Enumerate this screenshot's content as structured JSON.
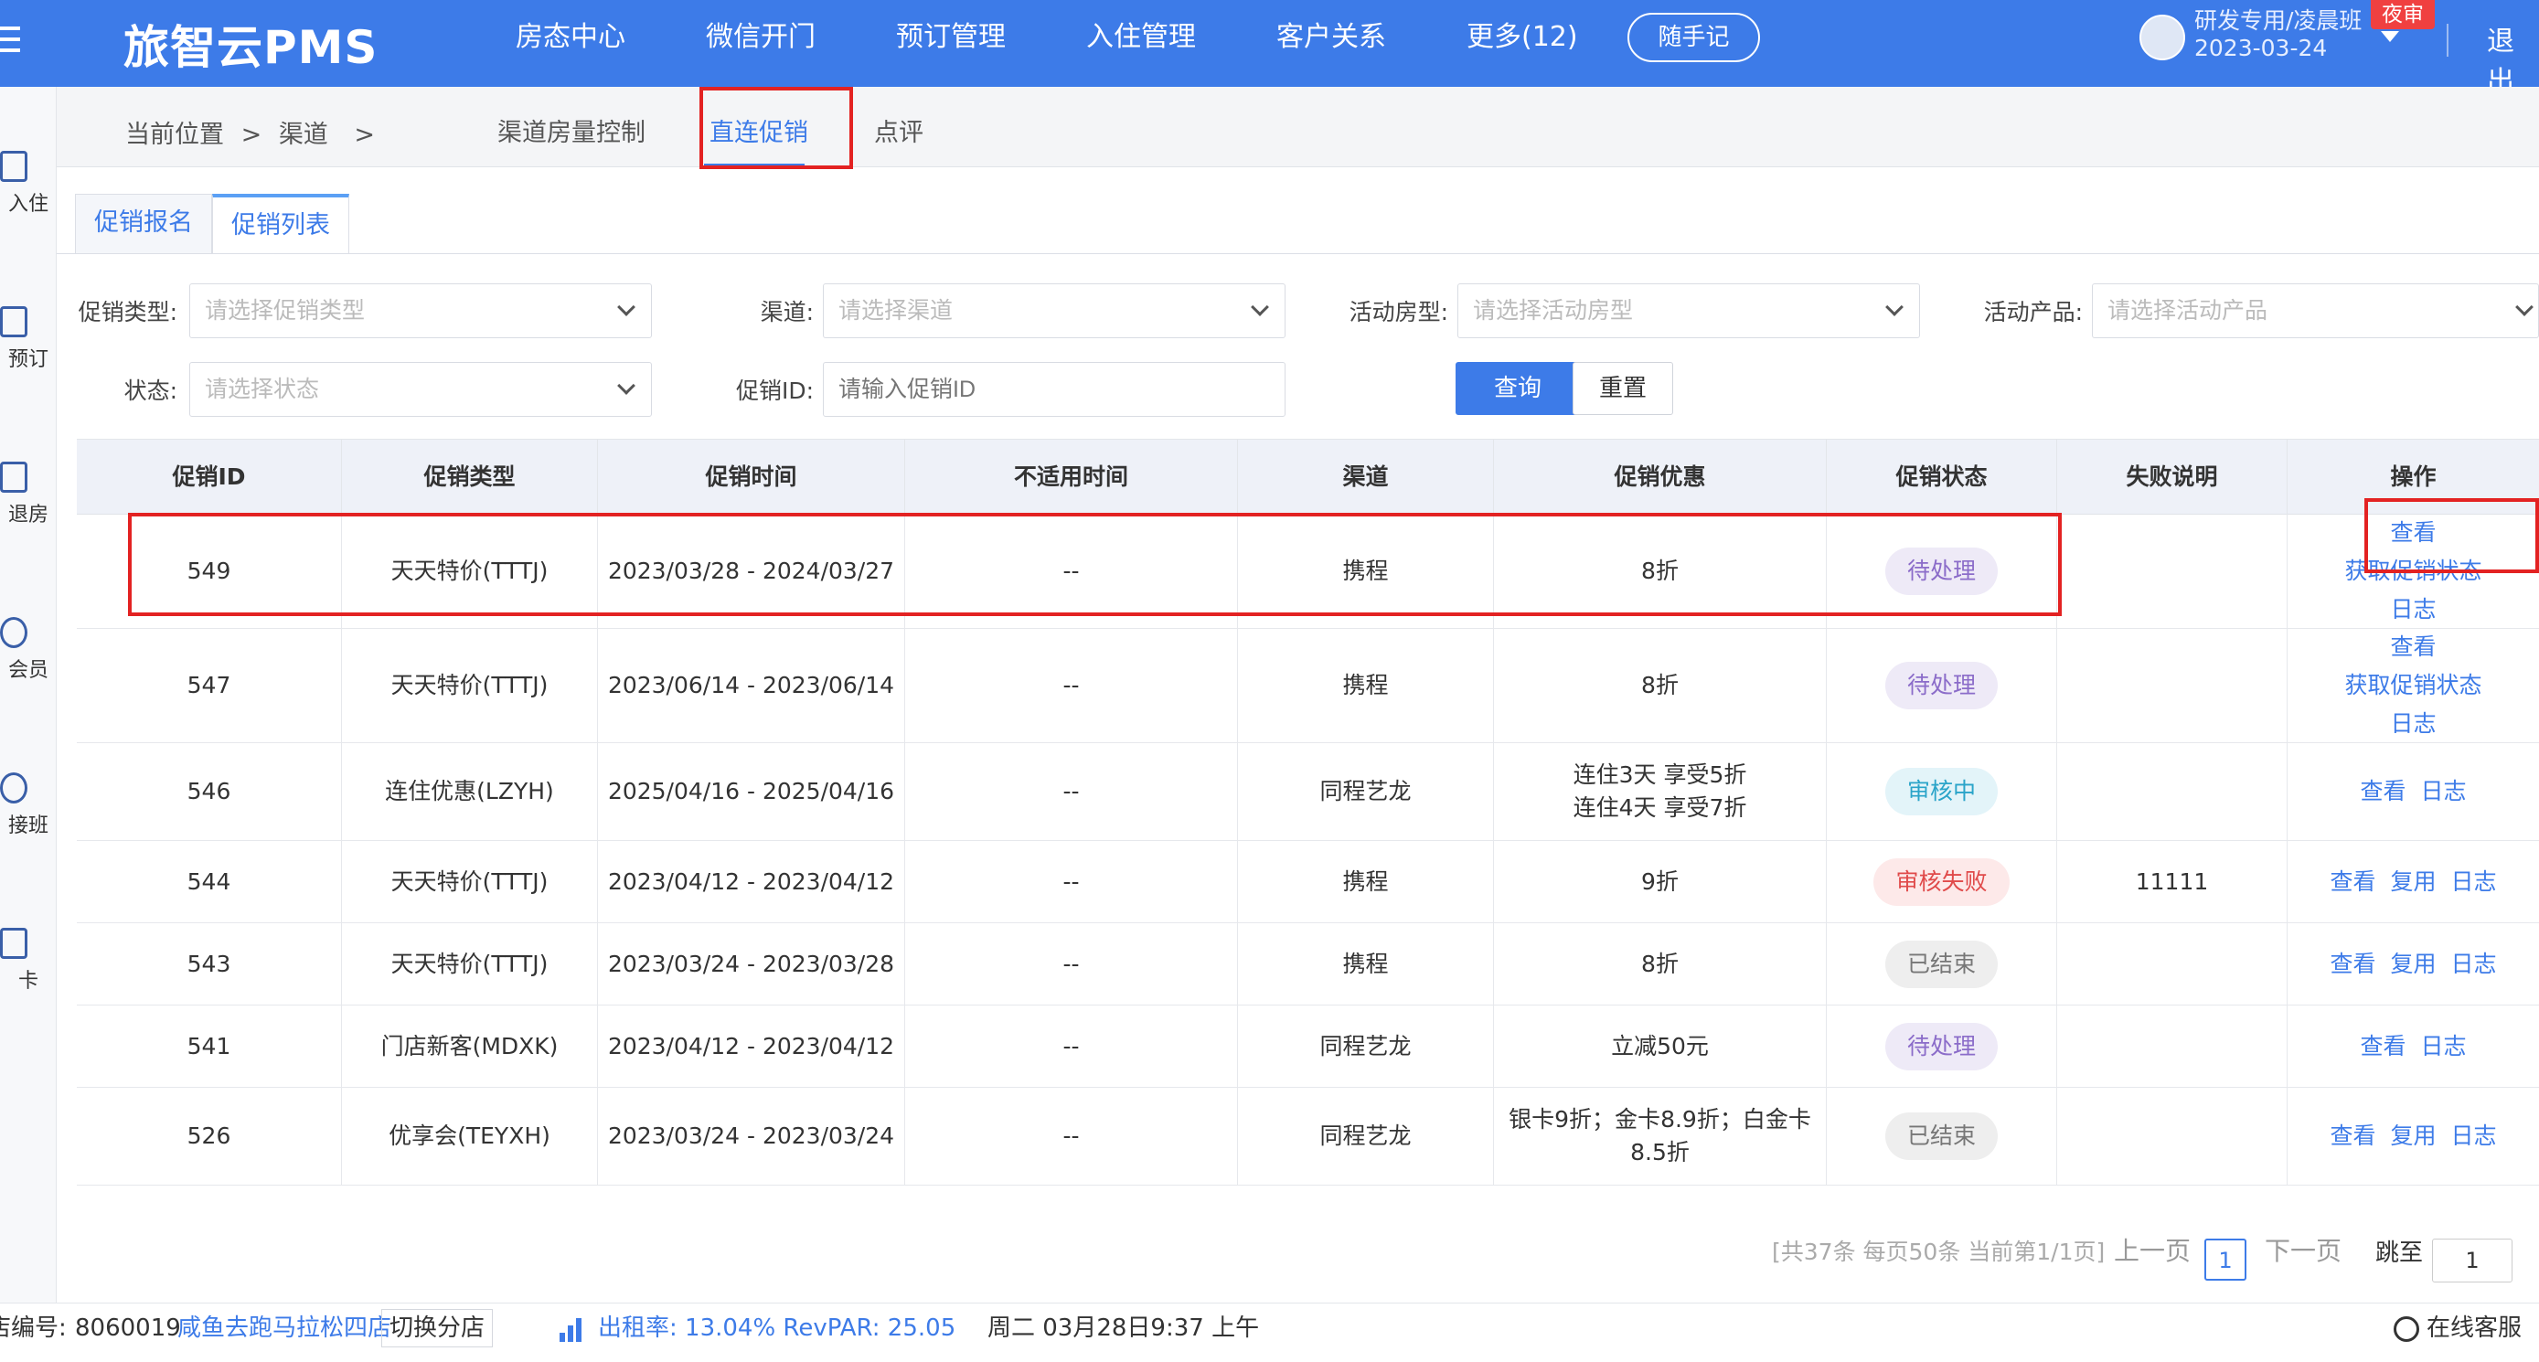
{
  "header": {
    "logo": "旅智云PMS",
    "nav": [
      "房态中心",
      "微信开门",
      "预订管理",
      "入住管理",
      "客户关系",
      "更多(12)"
    ],
    "memo_button": "随手记",
    "user_name": "研发专用/凌晨班",
    "user_date": "2023-03-24",
    "night_badge": "夜审",
    "logout": "退出"
  },
  "sidebar": {
    "items": [
      "入住",
      "预订",
      "退房",
      "会员",
      "接班",
      "卡"
    ]
  },
  "breadcrumb": {
    "label": "当前位置",
    "sep": ">",
    "channel": "渠道",
    "sep2": ">",
    "tabs": [
      "渠道房量控制",
      "直连促销",
      "点评"
    ],
    "active_tab": "直连促销"
  },
  "subtabs": [
    "促销报名",
    "促销列表"
  ],
  "filters": {
    "promo_type": {
      "label": "促销类型:",
      "placeholder": "请选择促销类型"
    },
    "channel": {
      "label": "渠道:",
      "placeholder": "请选择渠道"
    },
    "room_type": {
      "label": "活动房型:",
      "placeholder": "请选择活动房型"
    },
    "product": {
      "label": "活动产品:",
      "placeholder": "请选择活动产品"
    },
    "status": {
      "label": "状态:",
      "placeholder": "请选择状态"
    },
    "promo_id": {
      "label": "促销ID:",
      "placeholder": "请输入促销ID"
    },
    "query_button": "查询",
    "reset_button": "重置"
  },
  "table": {
    "headers": [
      "促销ID",
      "促销类型",
      "促销时间",
      "不适用时间",
      "渠道",
      "促销优惠",
      "促销状态",
      "失败说明",
      "操作"
    ],
    "rows": [
      {
        "id": "549",
        "type": "天天特价(TTTJ)",
        "time": "2023/03/28 - 2024/03/27",
        "excluded": "--",
        "channel": "携程",
        "discount": "8折",
        "status": "待处理",
        "status_kind": "pend",
        "fail": "",
        "ops": [
          "查看",
          "获取促销状态",
          "日志"
        ]
      },
      {
        "id": "547",
        "type": "天天特价(TTTJ)",
        "time": "2023/06/14 - 2023/06/14",
        "excluded": "--",
        "channel": "携程",
        "discount": "8折",
        "status": "待处理",
        "status_kind": "pend",
        "fail": "",
        "ops": [
          "查看",
          "获取促销状态",
          "日志"
        ]
      },
      {
        "id": "546",
        "type": "连住优惠(LZYH)",
        "time": "2025/04/16 - 2025/04/16",
        "excluded": "--",
        "channel": "同程艺龙",
        "discount": "连住3天 享受5折\n连住4天 享受7折",
        "status": "审核中",
        "status_kind": "rev",
        "fail": "",
        "ops": [
          "查看",
          "日志"
        ]
      },
      {
        "id": "544",
        "type": "天天特价(TTTJ)",
        "time": "2023/04/12 - 2023/04/12",
        "excluded": "--",
        "channel": "携程",
        "discount": "9折",
        "status": "审核失败",
        "status_kind": "fail",
        "fail": "11111",
        "ops": [
          "查看",
          "复用",
          "日志"
        ]
      },
      {
        "id": "543",
        "type": "天天特价(TTTJ)",
        "time": "2023/03/24 - 2023/03/28",
        "excluded": "--",
        "channel": "携程",
        "discount": "8折",
        "status": "已结束",
        "status_kind": "end",
        "fail": "",
        "ops": [
          "查看",
          "复用",
          "日志"
        ]
      },
      {
        "id": "541",
        "type": "门店新客(MDXK)",
        "time": "2023/04/12 - 2023/04/12",
        "excluded": "--",
        "channel": "同程艺龙",
        "discount": "立减50元",
        "status": "待处理",
        "status_kind": "pend",
        "fail": "",
        "ops": [
          "查看",
          "日志"
        ]
      },
      {
        "id": "526",
        "type": "优享会(TEYXH)",
        "time": "2023/03/24 - 2023/03/24",
        "excluded": "--",
        "channel": "同程艺龙",
        "discount": "银卡9折；金卡8.9折；白金卡\n8.5折",
        "status": "已结束",
        "status_kind": "end",
        "fail": "",
        "ops": [
          "查看",
          "复用",
          "日志"
        ]
      }
    ]
  },
  "pager": {
    "summary": "[共37条 每页50条 当前第1/1页]",
    "prev": "上一页",
    "current": "1",
    "next": "下一页",
    "jump": "跳至",
    "jump_value": "1"
  },
  "status_bar": {
    "store_label": "店编号:",
    "store_id": "8060019",
    "store_name": "咸鱼去跑马拉松四店",
    "switch": "切换分店",
    "occupancy": "出租率: 13.04% RevPAR: 25.05",
    "datetime": "周二 03月28日9:37 上午",
    "service": "在线客服"
  },
  "colors": {
    "primary": "#3d7be8",
    "highlight": "#e32222"
  }
}
